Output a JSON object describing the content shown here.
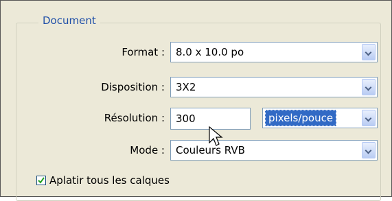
{
  "group": {
    "title": "Document"
  },
  "fields": {
    "format": {
      "label": "Format :",
      "value": "8.0 x 10.0 po"
    },
    "disposition": {
      "label": "Disposition :",
      "value": "3X2"
    },
    "resolution": {
      "label": "Résolution :",
      "value": "300",
      "unit": "pixels/pouce"
    },
    "mode": {
      "label": "Mode :",
      "value": "Couleurs RVB"
    }
  },
  "flatten": {
    "label": "Aplatir tous les calques",
    "checked": true
  },
  "icons": {
    "dropdown": "chevron-down-icon",
    "check": "checkmark-icon",
    "cursor": "arrow-pointer-icon"
  },
  "colors": {
    "panel_bg": "#ece9d8",
    "legend_text": "#1f4fa8",
    "field_border": "#7f9db9",
    "selection_bg": "#316ac5"
  }
}
